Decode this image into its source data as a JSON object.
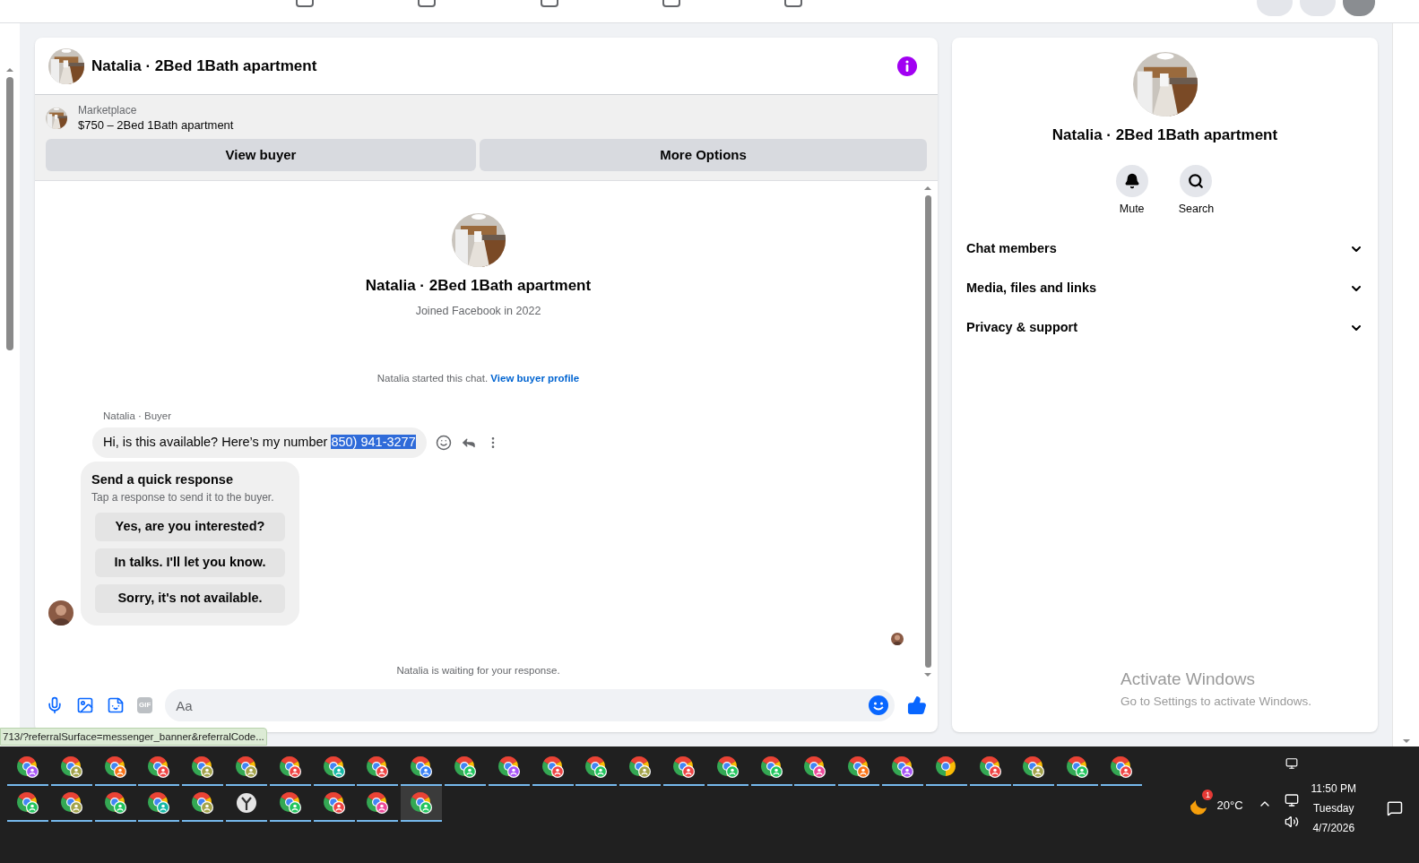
{
  "conversation": {
    "title": "Natalia · 2Bed 1Bath apartment",
    "marketplace": {
      "label": "Marketplace",
      "listing": "$750 – 2Bed 1Bath apartment"
    },
    "buttons": [
      "View buyer",
      "More Options"
    ],
    "intro": {
      "name": "Natalia · 2Bed 1Bath apartment",
      "joined": "Joined Facebook in 2022"
    },
    "started_note": {
      "text": "Natalia started this chat.",
      "link": "View buyer profile"
    },
    "message": {
      "sender": "Natalia · Buyer",
      "text": "Hi, is this available? Here’s my number ",
      "highlighted": "850) 941-3277"
    },
    "quick_response": {
      "title": "Send a quick response",
      "subtitle": "Tap a response to send it to the buyer.",
      "options": [
        "Yes, are you interested?",
        "In talks. I'll let you know.",
        "Sorry, it's not available."
      ]
    },
    "waiting_note": "Natalia is waiting for your response.",
    "composer": {
      "placeholder": "Aa",
      "gif_label": "GIF"
    }
  },
  "details": {
    "name": "Natalia · 2Bed 1Bath apartment",
    "actions": [
      {
        "label": "Mute",
        "kind": "bell"
      },
      {
        "label": "Search",
        "kind": "search"
      }
    ],
    "sections": [
      {
        "label": "Chat members",
        "expanded": false
      },
      {
        "label": "Media, files and links",
        "expanded": false
      },
      {
        "label": "Privacy & support",
        "expanded": false
      }
    ]
  },
  "status_url": "713/?referralSurface=messenger_banner&referralCode...",
  "windows_notice": {
    "title": "Activate Windows",
    "subtitle": "Go to Settings to activate Windows."
  },
  "taskbar": {
    "rows": [
      [
        {
          "kind": "browser",
          "color": "#a855f7",
          "selected": false
        },
        {
          "kind": "browser",
          "color": "#a3a34a",
          "selected": false
        },
        {
          "kind": "browser",
          "color": "#f97316",
          "selected": false
        },
        {
          "kind": "browser",
          "color": "#ef4444",
          "selected": false
        },
        {
          "kind": "browser",
          "color": "#a3a34a",
          "selected": false
        },
        {
          "kind": "browser",
          "color": "#a3a34a",
          "selected": false
        },
        {
          "kind": "browser",
          "color": "#ef4444",
          "selected": false
        },
        {
          "kind": "browser",
          "color": "#14b8a6",
          "selected": false
        },
        {
          "kind": "browser",
          "color": "#ef4444",
          "selected": false
        },
        {
          "kind": "browser",
          "color": "#3b82f6",
          "selected": false
        },
        {
          "kind": "browser",
          "color": "#22c55e",
          "selected": false
        },
        {
          "kind": "browser",
          "color": "#a855f7",
          "selected": false
        },
        {
          "kind": "browser",
          "color": "#ef4444",
          "selected": false
        },
        {
          "kind": "browser",
          "color": "#22c55e",
          "selected": false
        },
        {
          "kind": "browser",
          "color": "#a3a34a",
          "selected": false
        },
        {
          "kind": "browser",
          "color": "#ef4444",
          "selected": false
        },
        {
          "kind": "browser",
          "color": "#22c55e",
          "selected": false
        },
        {
          "kind": "browser",
          "color": "#22c55e",
          "selected": false
        },
        {
          "kind": "browser",
          "color": "#ec4899",
          "selected": false
        },
        {
          "kind": "browser",
          "color": "#f97316",
          "selected": false
        },
        {
          "kind": "browser",
          "color": "#a855f7",
          "selected": false
        },
        {
          "kind": "plain",
          "selected": false
        },
        {
          "kind": "browser",
          "color": "#ef4444",
          "selected": false
        },
        {
          "kind": "browser",
          "color": "#a3a34a",
          "selected": false
        },
        {
          "kind": "browser",
          "color": "#22c55e",
          "selected": false
        },
        {
          "kind": "browser",
          "color": "#ef4444",
          "selected": false
        }
      ],
      [
        {
          "kind": "browser",
          "color": "#22c55e",
          "selected": false
        },
        {
          "kind": "browser",
          "color": "#a3a34a",
          "selected": false
        },
        {
          "kind": "browser",
          "color": "#22c55e",
          "selected": false
        },
        {
          "kind": "browser",
          "color": "#14b8a6",
          "selected": false
        },
        {
          "kind": "browser",
          "color": "#a3a34a",
          "selected": false
        },
        {
          "kind": "clock",
          "selected": false
        },
        {
          "kind": "browser",
          "color": "#22c55e",
          "selected": false
        },
        {
          "kind": "browser",
          "color": "#ef4444",
          "selected": false
        },
        {
          "kind": "browser",
          "color": "#ec4899",
          "selected": false
        },
        {
          "kind": "browser",
          "color": "#22c55e",
          "selected": true
        }
      ]
    ],
    "weather": {
      "temp": "20°C",
      "badge": "1"
    },
    "clock": {
      "time": "11:50 PM",
      "day": "Tuesday",
      "date": "4/7/2026"
    }
  }
}
